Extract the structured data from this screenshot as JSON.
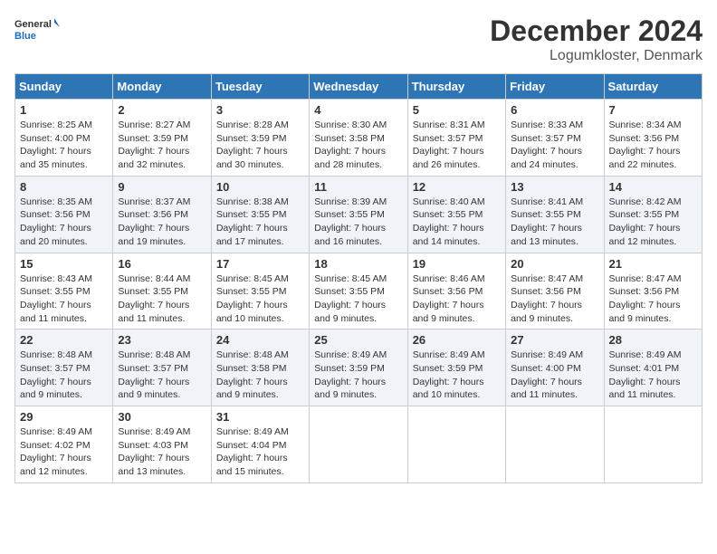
{
  "header": {
    "logo_general": "General",
    "logo_blue": "Blue",
    "month_title": "December 2024",
    "location": "Logumkloster, Denmark"
  },
  "days_of_week": [
    "Sunday",
    "Monday",
    "Tuesday",
    "Wednesday",
    "Thursday",
    "Friday",
    "Saturday"
  ],
  "weeks": [
    [
      {
        "day": "1",
        "sunrise": "8:25 AM",
        "sunset": "4:00 PM",
        "daylight": "7 hours and 35 minutes."
      },
      {
        "day": "2",
        "sunrise": "8:27 AM",
        "sunset": "3:59 PM",
        "daylight": "7 hours and 32 minutes."
      },
      {
        "day": "3",
        "sunrise": "8:28 AM",
        "sunset": "3:59 PM",
        "daylight": "7 hours and 30 minutes."
      },
      {
        "day": "4",
        "sunrise": "8:30 AM",
        "sunset": "3:58 PM",
        "daylight": "7 hours and 28 minutes."
      },
      {
        "day": "5",
        "sunrise": "8:31 AM",
        "sunset": "3:57 PM",
        "daylight": "7 hours and 26 minutes."
      },
      {
        "day": "6",
        "sunrise": "8:33 AM",
        "sunset": "3:57 PM",
        "daylight": "7 hours and 24 minutes."
      },
      {
        "day": "7",
        "sunrise": "8:34 AM",
        "sunset": "3:56 PM",
        "daylight": "7 hours and 22 minutes."
      }
    ],
    [
      {
        "day": "8",
        "sunrise": "8:35 AM",
        "sunset": "3:56 PM",
        "daylight": "7 hours and 20 minutes."
      },
      {
        "day": "9",
        "sunrise": "8:37 AM",
        "sunset": "3:56 PM",
        "daylight": "7 hours and 19 minutes."
      },
      {
        "day": "10",
        "sunrise": "8:38 AM",
        "sunset": "3:55 PM",
        "daylight": "7 hours and 17 minutes."
      },
      {
        "day": "11",
        "sunrise": "8:39 AM",
        "sunset": "3:55 PM",
        "daylight": "7 hours and 16 minutes."
      },
      {
        "day": "12",
        "sunrise": "8:40 AM",
        "sunset": "3:55 PM",
        "daylight": "7 hours and 14 minutes."
      },
      {
        "day": "13",
        "sunrise": "8:41 AM",
        "sunset": "3:55 PM",
        "daylight": "7 hours and 13 minutes."
      },
      {
        "day": "14",
        "sunrise": "8:42 AM",
        "sunset": "3:55 PM",
        "daylight": "7 hours and 12 minutes."
      }
    ],
    [
      {
        "day": "15",
        "sunrise": "8:43 AM",
        "sunset": "3:55 PM",
        "daylight": "7 hours and 11 minutes."
      },
      {
        "day": "16",
        "sunrise": "8:44 AM",
        "sunset": "3:55 PM",
        "daylight": "7 hours and 11 minutes."
      },
      {
        "day": "17",
        "sunrise": "8:45 AM",
        "sunset": "3:55 PM",
        "daylight": "7 hours and 10 minutes."
      },
      {
        "day": "18",
        "sunrise": "8:45 AM",
        "sunset": "3:55 PM",
        "daylight": "7 hours and 9 minutes."
      },
      {
        "day": "19",
        "sunrise": "8:46 AM",
        "sunset": "3:56 PM",
        "daylight": "7 hours and 9 minutes."
      },
      {
        "day": "20",
        "sunrise": "8:47 AM",
        "sunset": "3:56 PM",
        "daylight": "7 hours and 9 minutes."
      },
      {
        "day": "21",
        "sunrise": "8:47 AM",
        "sunset": "3:56 PM",
        "daylight": "7 hours and 9 minutes."
      }
    ],
    [
      {
        "day": "22",
        "sunrise": "8:48 AM",
        "sunset": "3:57 PM",
        "daylight": "7 hours and 9 minutes."
      },
      {
        "day": "23",
        "sunrise": "8:48 AM",
        "sunset": "3:57 PM",
        "daylight": "7 hours and 9 minutes."
      },
      {
        "day": "24",
        "sunrise": "8:48 AM",
        "sunset": "3:58 PM",
        "daylight": "7 hours and 9 minutes."
      },
      {
        "day": "25",
        "sunrise": "8:49 AM",
        "sunset": "3:59 PM",
        "daylight": "7 hours and 9 minutes."
      },
      {
        "day": "26",
        "sunrise": "8:49 AM",
        "sunset": "3:59 PM",
        "daylight": "7 hours and 10 minutes."
      },
      {
        "day": "27",
        "sunrise": "8:49 AM",
        "sunset": "4:00 PM",
        "daylight": "7 hours and 11 minutes."
      },
      {
        "day": "28",
        "sunrise": "8:49 AM",
        "sunset": "4:01 PM",
        "daylight": "7 hours and 11 minutes."
      }
    ],
    [
      {
        "day": "29",
        "sunrise": "8:49 AM",
        "sunset": "4:02 PM",
        "daylight": "7 hours and 12 minutes."
      },
      {
        "day": "30",
        "sunrise": "8:49 AM",
        "sunset": "4:03 PM",
        "daylight": "7 hours and 13 minutes."
      },
      {
        "day": "31",
        "sunrise": "8:49 AM",
        "sunset": "4:04 PM",
        "daylight": "7 hours and 15 minutes."
      },
      null,
      null,
      null,
      null
    ]
  ]
}
